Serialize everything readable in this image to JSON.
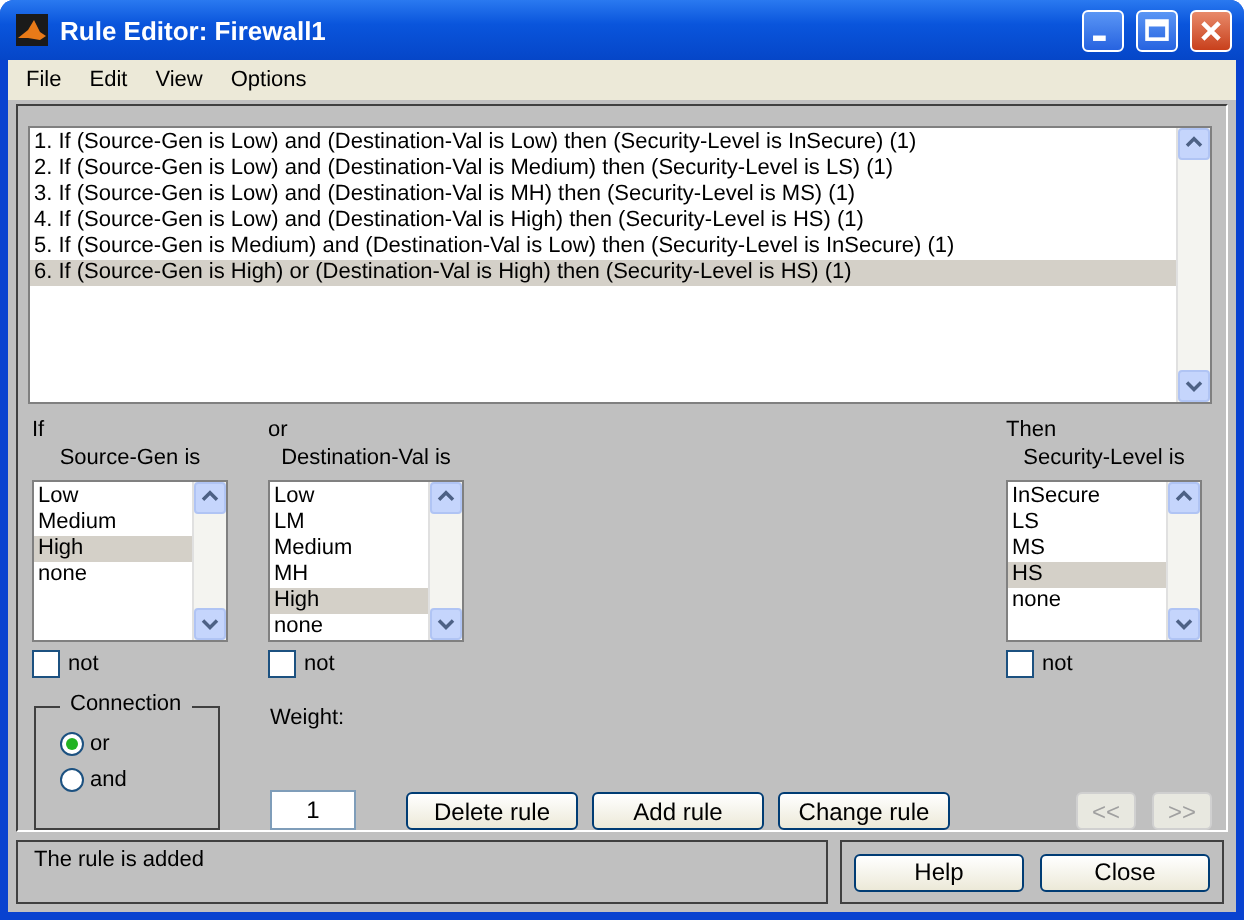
{
  "window": {
    "title": "Rule Editor: Firewall1"
  },
  "menu": [
    "File",
    "Edit",
    "View",
    "Options"
  ],
  "rules": [
    {
      "text": "1. If (Source-Gen is Low) and (Destination-Val is Low) then (Security-Level is InSecure) (1)",
      "selected": false
    },
    {
      "text": "2. If (Source-Gen is Low) and (Destination-Val is Medium) then (Security-Level is LS) (1)",
      "selected": false
    },
    {
      "text": "3. If (Source-Gen is Low) and (Destination-Val is MH) then (Security-Level is MS) (1)",
      "selected": false
    },
    {
      "text": "4. If (Source-Gen is Low) and (Destination-Val is High) then (Security-Level is HS) (1)",
      "selected": false
    },
    {
      "text": "5. If (Source-Gen is Medium) and (Destination-Val is Low) then (Security-Level is InSecure) (1)",
      "selected": false
    },
    {
      "text": "6. If (Source-Gen is High) or (Destination-Val is High) then (Security-Level is HS) (1)",
      "selected": true
    }
  ],
  "variables": [
    {
      "heading": "If",
      "label": "Source-Gen is",
      "items": [
        {
          "label": "Low",
          "selected": false
        },
        {
          "label": "Medium",
          "selected": false
        },
        {
          "label": "High",
          "selected": true
        },
        {
          "label": "none",
          "selected": false
        }
      ],
      "not": {
        "label": "not",
        "checked": false
      }
    },
    {
      "heading": "or",
      "label": "Destination-Val is",
      "items": [
        {
          "label": "Low",
          "selected": false
        },
        {
          "label": "LM",
          "selected": false
        },
        {
          "label": "Medium",
          "selected": false
        },
        {
          "label": "MH",
          "selected": false
        },
        {
          "label": "High",
          "selected": true
        },
        {
          "label": "none",
          "selected": false
        }
      ],
      "not": {
        "label": "not",
        "checked": false
      }
    },
    {
      "heading": "Then",
      "label": "Security-Level is",
      "items": [
        {
          "label": "InSecure",
          "selected": false
        },
        {
          "label": "LS",
          "selected": false
        },
        {
          "label": "MS",
          "selected": false
        },
        {
          "label": "HS",
          "selected": true
        },
        {
          "label": "none",
          "selected": false
        }
      ],
      "not": {
        "label": "not",
        "checked": false
      }
    }
  ],
  "connection": {
    "title": "Connection",
    "options": [
      {
        "label": "or",
        "selected": true
      },
      {
        "label": "and",
        "selected": false
      }
    ]
  },
  "weight": {
    "label": "Weight:",
    "value": "1"
  },
  "buttons": [
    "Delete rule",
    "Add rule",
    "Change rule"
  ],
  "nav_buttons": [
    {
      "label": "<<",
      "disabled": true
    },
    {
      "label": ">>",
      "disabled": true
    }
  ],
  "status": "The rule is added",
  "footer_buttons": [
    "Help",
    "Close"
  ]
}
